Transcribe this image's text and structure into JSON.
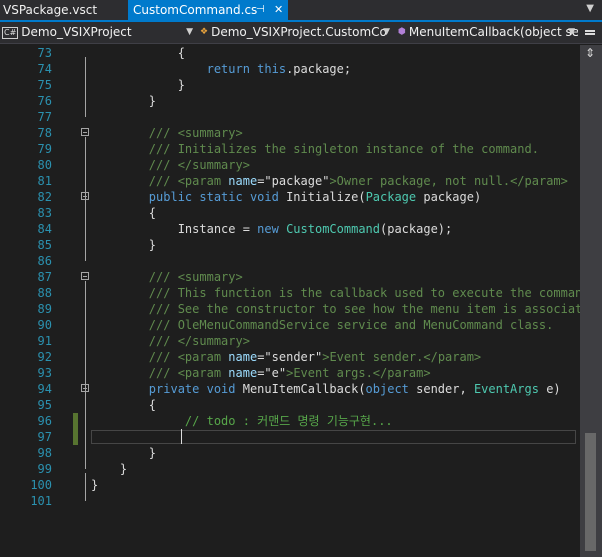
{
  "tabs": [
    {
      "label": "VSPackage.vsct",
      "active": false
    },
    {
      "label": "CustomCommand.cs",
      "active": true
    }
  ],
  "tab_icons": {
    "pin": "pin-icon",
    "close": "close-icon",
    "overflow": "chevron-down-icon"
  },
  "nav": {
    "project": "Demo_VSIXProject",
    "class": "Demo_VSIXProject.CustomCo",
    "member": "MenuItemCallback(object sender"
  },
  "colors": {
    "accent": "#007acc",
    "keyword": "#569cd6",
    "type": "#4ec9b0",
    "comment": "#57a64a",
    "line_number": "#2b91af"
  },
  "code_lines": [
    {
      "n": "73",
      "parts": [
        [
          "plain",
          "            {"
        ]
      ]
    },
    {
      "n": "74",
      "parts": [
        [
          "kw",
          "                return "
        ],
        [
          "kw",
          "this"
        ],
        [
          "plain",
          ".package;"
        ]
      ]
    },
    {
      "n": "75",
      "parts": [
        [
          "plain",
          "            }"
        ]
      ]
    },
    {
      "n": "76",
      "parts": [
        [
          "plain",
          "        }"
        ]
      ]
    },
    {
      "n": "77",
      "parts": []
    },
    {
      "n": "78",
      "parts": [
        [
          "dc",
          "        /// "
        ],
        [
          "tag",
          "<summary>"
        ]
      ]
    },
    {
      "n": "79",
      "parts": [
        [
          "dc",
          "        /// Initializes the singleton instance of the command."
        ]
      ]
    },
    {
      "n": "80",
      "parts": [
        [
          "dc",
          "        /// "
        ],
        [
          "tag",
          "</summary>"
        ]
      ]
    },
    {
      "n": "81",
      "parts": [
        [
          "dc",
          "        /// "
        ],
        [
          "tag",
          "<param "
        ],
        [
          "attr",
          "name"
        ],
        [
          "plain",
          "="
        ],
        [
          "plain",
          "\"package\""
        ],
        [
          "tag",
          ">Owner package, not null.</param>"
        ]
      ]
    },
    {
      "n": "82",
      "parts": [
        [
          "kw",
          "        public static void "
        ],
        [
          "plain",
          "Initialize("
        ],
        [
          "ty",
          "Package"
        ],
        [
          "plain",
          " package)"
        ]
      ]
    },
    {
      "n": "83",
      "parts": [
        [
          "plain",
          "        {"
        ]
      ]
    },
    {
      "n": "84",
      "parts": [
        [
          "plain",
          "            Instance = "
        ],
        [
          "kw",
          "new "
        ],
        [
          "ty",
          "CustomCommand"
        ],
        [
          "plain",
          "(package);"
        ]
      ]
    },
    {
      "n": "85",
      "parts": [
        [
          "plain",
          "        }"
        ]
      ]
    },
    {
      "n": "86",
      "parts": []
    },
    {
      "n": "87",
      "parts": [
        [
          "dc",
          "        /// "
        ],
        [
          "tag",
          "<summary>"
        ]
      ]
    },
    {
      "n": "88",
      "parts": [
        [
          "dc",
          "        /// This function is the callback used to execute the command"
        ]
      ]
    },
    {
      "n": "89",
      "parts": [
        [
          "dc",
          "        /// See the constructor to see how the menu item is associated"
        ]
      ]
    },
    {
      "n": "90",
      "parts": [
        [
          "dc",
          "        /// OleMenuCommandService service and MenuCommand class."
        ]
      ]
    },
    {
      "n": "91",
      "parts": [
        [
          "dc",
          "        /// "
        ],
        [
          "tag",
          "</summary>"
        ]
      ]
    },
    {
      "n": "92",
      "parts": [
        [
          "dc",
          "        /// "
        ],
        [
          "tag",
          "<param "
        ],
        [
          "attr",
          "name"
        ],
        [
          "plain",
          "="
        ],
        [
          "plain",
          "\"sender\""
        ],
        [
          "tag",
          ">Event sender.</param>"
        ]
      ]
    },
    {
      "n": "93",
      "parts": [
        [
          "dc",
          "        /// "
        ],
        [
          "tag",
          "<param "
        ],
        [
          "attr",
          "name"
        ],
        [
          "plain",
          "="
        ],
        [
          "plain",
          "\"e\""
        ],
        [
          "tag",
          ">Event args.</param>"
        ]
      ]
    },
    {
      "n": "94",
      "parts": [
        [
          "kw",
          "        private void "
        ],
        [
          "plain",
          "MenuItemCallback("
        ],
        [
          "kw",
          "object"
        ],
        [
          "plain",
          " sender, "
        ],
        [
          "ty",
          "EventArgs"
        ],
        [
          "plain",
          " e)"
        ]
      ]
    },
    {
      "n": "95",
      "parts": [
        [
          "plain",
          "        {"
        ]
      ]
    },
    {
      "n": "96",
      "parts": [
        [
          "ko",
          "             // todo : 커맨드 명령 기능구현..."
        ]
      ]
    },
    {
      "n": "97",
      "parts": []
    },
    {
      "n": "98",
      "parts": [
        [
          "plain",
          "        }"
        ]
      ]
    },
    {
      "n": "99",
      "parts": [
        [
          "plain",
          "    }"
        ]
      ]
    },
    {
      "n": "100",
      "parts": [
        [
          "plain",
          "}"
        ]
      ]
    },
    {
      "n": "101",
      "parts": []
    }
  ]
}
